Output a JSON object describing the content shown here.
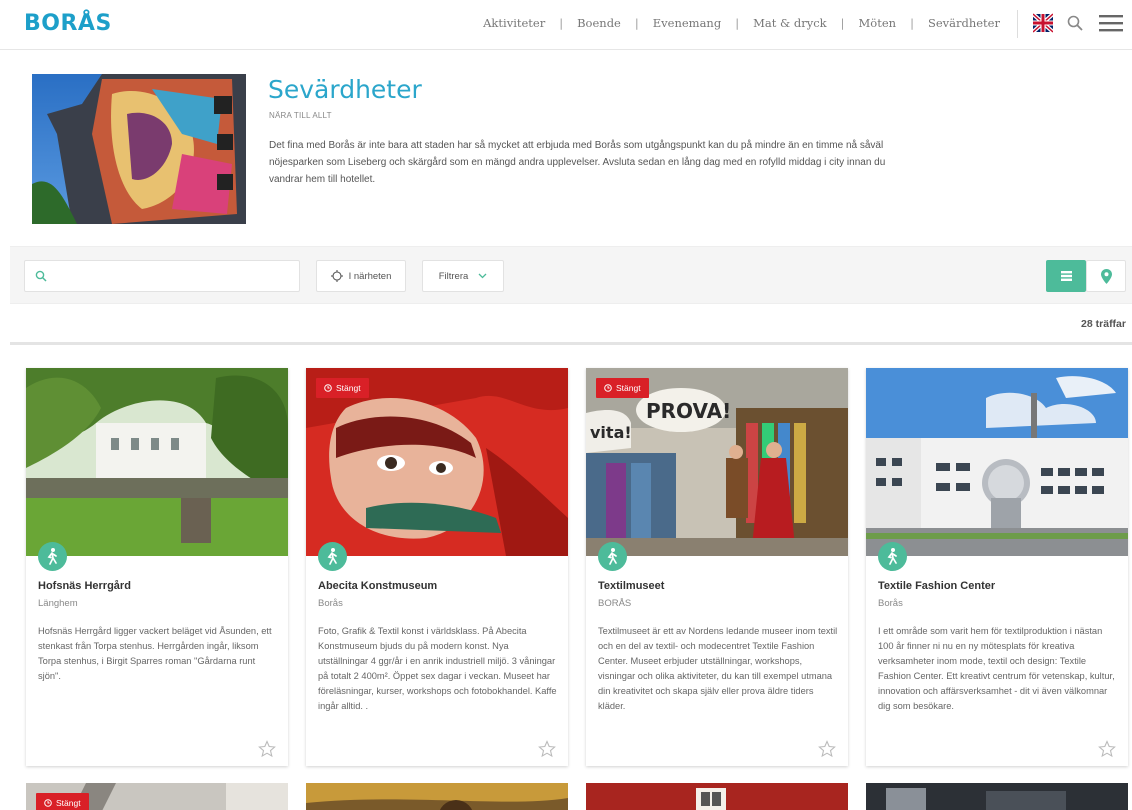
{
  "header": {
    "logo": "BORÅS",
    "nav": [
      "Aktiviteter",
      "Boende",
      "Evenemang",
      "Mat & dryck",
      "Möten",
      "Sevärdheter"
    ],
    "separator": "|"
  },
  "intro": {
    "title": "Sevärdheter",
    "subtitle": "NÄRA TILL ALLT",
    "text": "Det fina med Borås är inte bara att staden har så mycket att erbjuda med Borås som utgångspunkt kan du på mindre än en timme nå såväl nöjesparken som Liseberg och skärgård som en mängd andra upplevelser. Avsluta sedan en lång dag med en rofylld middag i city innan du vandrar hem till hotellet."
  },
  "filters": {
    "search_placeholder": "",
    "nearby_label": "I närheten",
    "filter_label": "Filtrera"
  },
  "results": {
    "count_text": "28 träffar"
  },
  "closed_label": "Stängt",
  "cards": [
    {
      "title": "Hofsnäs Herrgård",
      "location": "Länghem",
      "closed": false,
      "description": "Hofsnäs Herrgård ligger vackert beläget vid Åsunden, ett stenkast från Torpa stenhus. Herrgården ingår, liksom Torpa stenhus, i Birgit Sparres roman \"Gårdarna runt sjön\"."
    },
    {
      "title": "Abecita Konstmuseum",
      "location": "Borås",
      "closed": true,
      "description": "Foto, Grafik & Textil konst i världsklass.  På Abecita Konstmuseum bjuds du på modern konst. Nya utställningar 4 ggr/år i en anrik industriell miljö. 3 våningar på totalt 2 400m². Öppet sex dagar i veckan.  Museet har föreläsningar, kurser, workshops och fotobokhandel. Kaffe ingår alltid. ."
    },
    {
      "title": "Textilmuseet",
      "location": "BORÅS",
      "closed": true,
      "description": "Textilmuseet är ett av Nordens ledande museer inom textil och en del av textil- och modecentret Textile Fashion Center. Museet erbjuder utställningar, workshops, visningar och olika aktiviteter, du kan till exempel utmana din kreativitet och skapa själv eller prova äldre tiders kläder."
    },
    {
      "title": "Textile Fashion Center",
      "location": "Borås",
      "closed": false,
      "description": "I ett område som varit hem för textilproduktion i nästan 100 år finner ni nu en ny mötesplats för kreativa verksamheter inom mode, textil och design: Textile Fashion Center. Ett kreativt centrum för vetenskap, kultur, innovation och affärsverksamhet - dit vi även välkomnar dig som besökare."
    }
  ],
  "colors": {
    "brand": "#1d9fc9",
    "accent": "#4dbb9a",
    "closed": "#d92027"
  }
}
